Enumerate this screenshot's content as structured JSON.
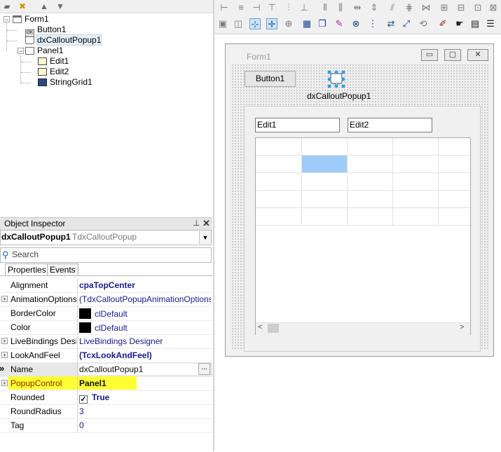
{
  "structure_tree": {
    "items": [
      {
        "label": "Form1",
        "icon": "form-icon"
      },
      {
        "label": "Button1",
        "icon": "button-component-icon"
      },
      {
        "label": "dxCalloutPopup1",
        "icon": "callout-popup-icon"
      },
      {
        "label": "Panel1",
        "icon": "panel-icon"
      },
      {
        "label": "Edit1",
        "icon": "edit-component-icon"
      },
      {
        "label": "Edit2",
        "icon": "edit-component-icon"
      },
      {
        "label": "StringGrid1",
        "icon": "stringgrid-component-icon"
      }
    ],
    "expand_symbol": "−"
  },
  "object_inspector": {
    "title": "Object Inspector",
    "selected_name": "dxCalloutPopup1",
    "selected_type": "TdxCalloutPopup",
    "search_placeholder": "Search",
    "tabs": [
      "Properties",
      "Events"
    ],
    "active_tab": "Properties",
    "properties": [
      {
        "name": "Alignment",
        "value": "cpaTopCenter",
        "bold": true
      },
      {
        "name": "AnimationOptions",
        "value": "(TdxCalloutPopupAnimationOptions)",
        "expandable": true
      },
      {
        "name": "BorderColor",
        "value": "clDefault",
        "swatch": "#000000"
      },
      {
        "name": "Color",
        "value": "clDefault",
        "swatch": "#000000"
      },
      {
        "name": "LiveBindings Designer",
        "value": "LiveBindings Designer",
        "expandable": true
      },
      {
        "name": "LookAndFeel",
        "value": "(TcxLookAndFeel)",
        "bold": true,
        "expandable": true
      },
      {
        "name": "Name",
        "value": "dxCalloutPopup1",
        "selected": true,
        "ellipsis": "..."
      },
      {
        "name": "PopupControl",
        "value": "Panel1",
        "bold": true,
        "highlight": "#ffff33",
        "expandable": true
      },
      {
        "name": "Rounded",
        "value": "True",
        "bold": true,
        "checkbox": true
      },
      {
        "name": "RoundRadius",
        "value": "3"
      },
      {
        "name": "Tag",
        "value": "0"
      }
    ],
    "row_indicator": "»"
  },
  "designer": {
    "form_caption": "Form1",
    "window_buttons": {
      "minimize": "▭",
      "maximize": "▢",
      "close": "✕"
    },
    "button1_label": "Button1",
    "callout_label": "dxCalloutPopup1",
    "edit1_value": "Edit1",
    "edit2_value": "Edit2",
    "scroll_left": "<",
    "scroll_right": ">"
  },
  "colors": {
    "selection_highlight": "#ffff33",
    "selected_cell": "#9ecbf7",
    "callout_handles": "#2aa0ef"
  }
}
